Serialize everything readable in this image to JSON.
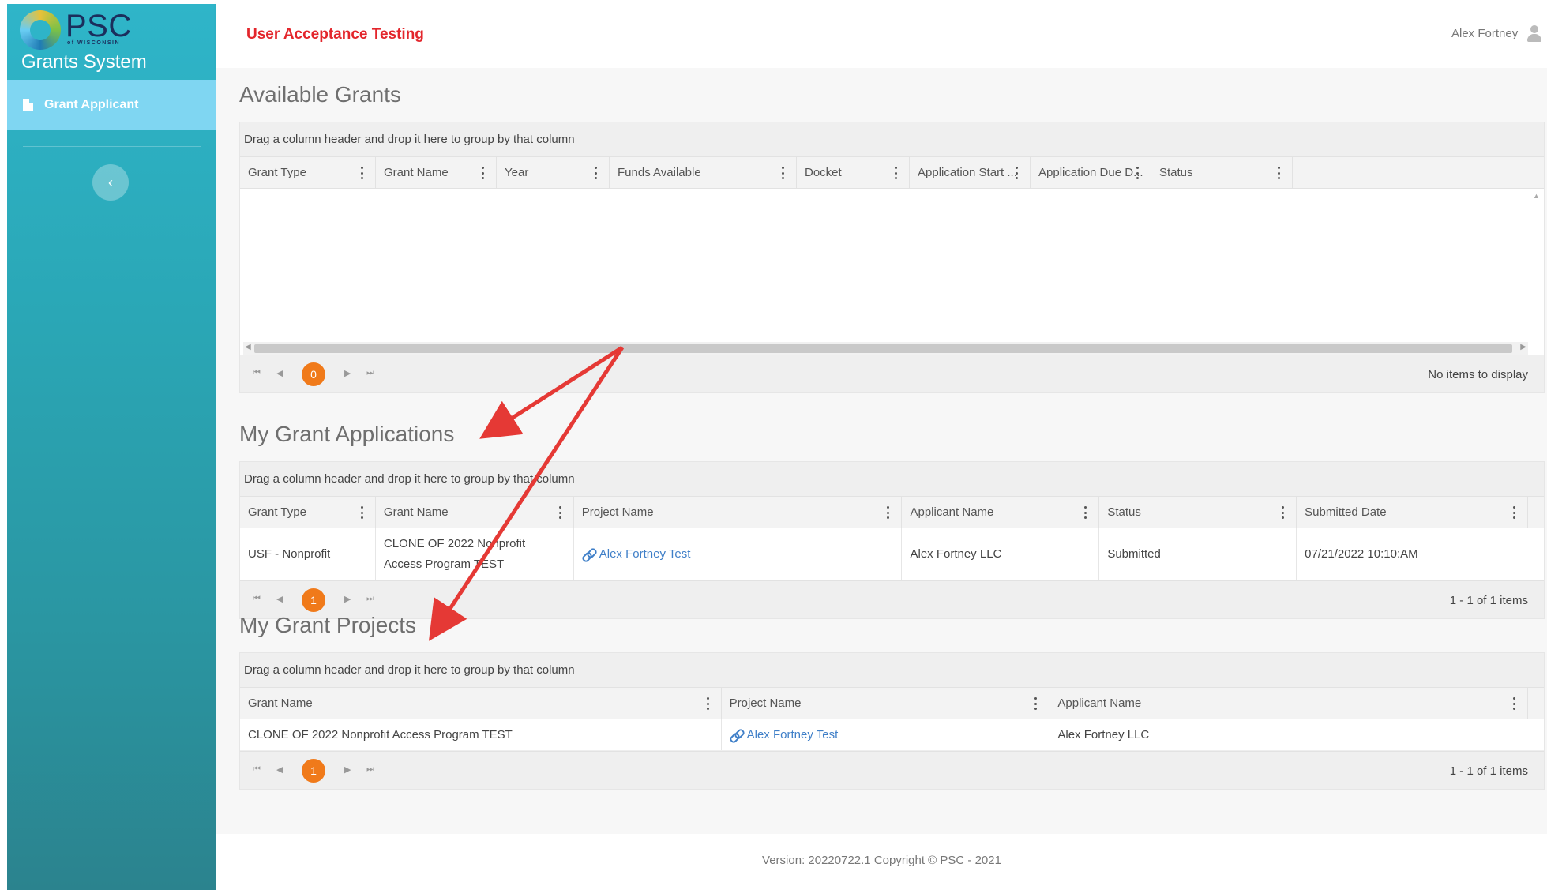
{
  "sidebar": {
    "logo": "PSC",
    "logo_sub": "of WISCONSIN",
    "app_name": "Grants System",
    "items": [
      {
        "label": "Grant Applicant",
        "icon": "document-icon"
      }
    ],
    "collapse_glyph": "‹"
  },
  "header": {
    "environment": "User Acceptance Testing",
    "user_name": "Alex Fortney"
  },
  "available_grants": {
    "title": "Available Grants",
    "group_hint": "Drag a column header and drop it here to group by that column",
    "columns": [
      "Grant Type",
      "Grant Name",
      "Year",
      "Funds Available",
      "Docket",
      "Application Start ...",
      "Application Due D...",
      "Status"
    ],
    "page": "0",
    "info": "No items to display"
  },
  "my_applications": {
    "title": "My Grant Applications",
    "group_hint": "Drag a column header and drop it here to group by that column",
    "columns": [
      "Grant Type",
      "Grant Name",
      "Project Name",
      "Applicant Name",
      "Status",
      "Submitted Date"
    ],
    "rows": [
      {
        "grant_type": "USF - Nonprofit",
        "grant_name": "CLONE OF 2022 Nonprofit Access Program TEST",
        "project_name": "Alex Fortney Test",
        "applicant_name": "Alex Fortney LLC",
        "status": "Submitted",
        "submitted_date": "07/21/2022 10:10:AM"
      }
    ],
    "page": "1",
    "info": "1 - 1 of 1 items"
  },
  "my_projects": {
    "title": "My Grant Projects",
    "group_hint": "Drag a column header and drop it here to group by that column",
    "columns": [
      "Grant Name",
      "Project Name",
      "Applicant Name"
    ],
    "rows": [
      {
        "grant_name": "CLONE OF 2022 Nonprofit Access Program TEST",
        "project_name": "Alex Fortney Test",
        "applicant_name": "Alex Fortney LLC"
      }
    ],
    "page": "1",
    "info": "1 - 1 of 1 items"
  },
  "pager_glyphs": {
    "first": "⏮",
    "prev": "◀",
    "next": "▶",
    "last": "⏭"
  },
  "footer": {
    "text": "Version: 20220722.1 Copyright © PSC - 2021"
  },
  "colors": {
    "sidebar": "#2fb5c9",
    "active_nav": "#7fd6f2",
    "accent": "#f07a1a",
    "env_label": "#e3262c",
    "link": "#3f7fc8",
    "annotation": "#e53935"
  }
}
